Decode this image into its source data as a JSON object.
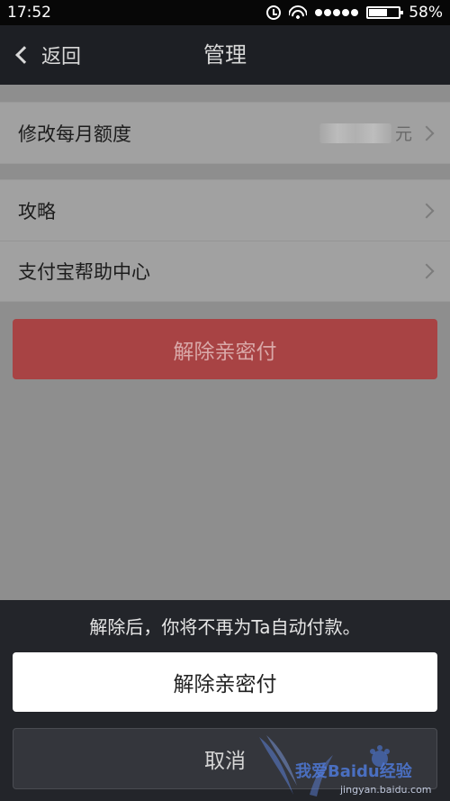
{
  "status": {
    "time": "17:52",
    "battery": "58%"
  },
  "nav": {
    "back_label": "返回",
    "title": "管理"
  },
  "settings": {
    "monthly_limit": {
      "label": "修改每月额度",
      "unit": "元"
    },
    "items": [
      {
        "label": "攻略"
      },
      {
        "label": "支付宝帮助中心"
      }
    ]
  },
  "danger_button": {
    "label": "解除亲密付"
  },
  "sheet": {
    "message": "解除后，你将不再为Ta自动付款。",
    "confirm_label": "解除亲密付",
    "cancel_label": "取消"
  },
  "watermark": {
    "text": "我爱Baidu经验",
    "url": "jingyan.baidu.com"
  },
  "colors": {
    "danger": "#a84344",
    "sheet_bg": "#23252a",
    "watermark": "#4f79d8"
  }
}
